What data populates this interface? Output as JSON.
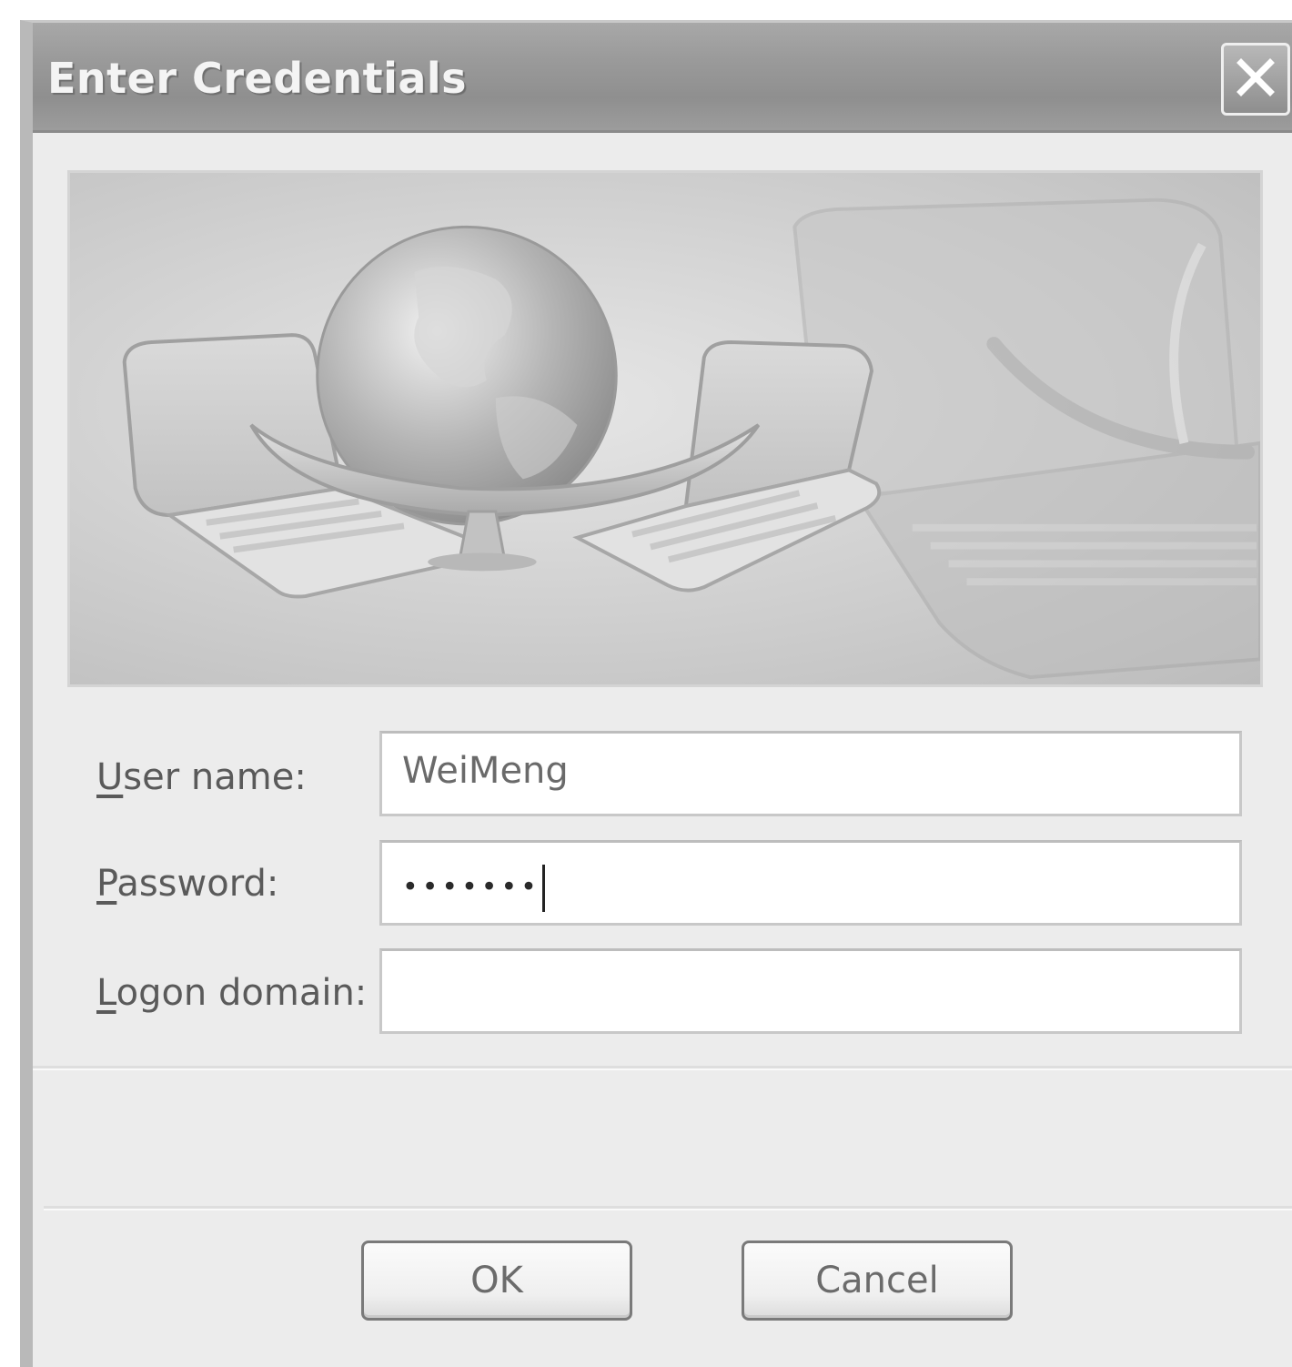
{
  "dialog": {
    "title": "Enter Credentials",
    "close_icon": "close-x-icon"
  },
  "banner": {
    "image": "globe-network-laptops-illustration"
  },
  "form": {
    "username_label": "User name:",
    "username_value": "WeiMeng",
    "password_label": "Password:",
    "password_mask": "•••••••",
    "domain_label": "Logon domain:",
    "domain_value": ""
  },
  "buttons": {
    "ok_label": "OK",
    "cancel_label": "Cancel"
  }
}
